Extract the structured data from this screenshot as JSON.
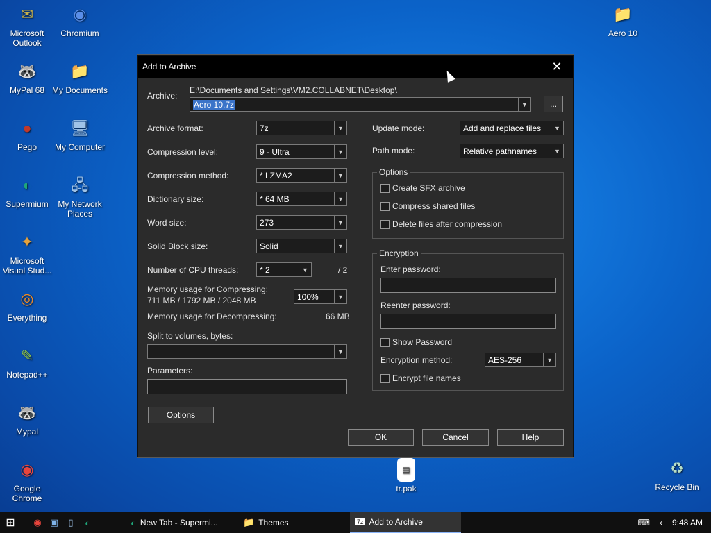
{
  "desktop": {
    "icons_left": [
      {
        "name": "microsoft-outlook",
        "label": "Microsoft Outlook",
        "glyph": "✉",
        "color": "#c8b24a"
      },
      {
        "name": "chromium",
        "label": "Chromium",
        "glyph": "◉",
        "color": "#5a8ee8"
      },
      {
        "name": "mypal-68",
        "label": "MyPal 68",
        "glyph": "🦝",
        "color": "#ffffff"
      },
      {
        "name": "my-documents",
        "label": "My Documents",
        "glyph": "📁",
        "color": "#f2d66b"
      },
      {
        "name": "pego",
        "label": "Pego",
        "glyph": "●",
        "color": "#c0392b"
      },
      {
        "name": "my-computer",
        "label": "My Computer",
        "glyph": "🖥",
        "color": "#9fc3e8"
      },
      {
        "name": "supermium",
        "label": "Supermium",
        "glyph": "◐",
        "color": "#1fa67a"
      },
      {
        "name": "my-network-places",
        "label": "My Network Places",
        "glyph": "🖧",
        "color": "#9fc3e8"
      },
      {
        "name": "microsoft-visual-studio",
        "label": "Microsoft Visual Stud...",
        "glyph": "✦",
        "color": "#e6a23c"
      },
      {
        "name": "everything",
        "label": "Everything",
        "glyph": "◎",
        "color": "#f08a24"
      },
      {
        "name": "notepad-plus-plus",
        "label": "Notepad++",
        "glyph": "✎",
        "color": "#8bc34a"
      },
      {
        "name": "mypal",
        "label": "Mypal",
        "glyph": "🦝",
        "color": "#ffffff"
      },
      {
        "name": "google-chrome",
        "label": "Google Chrome",
        "glyph": "◉",
        "color": "#e8453c"
      }
    ],
    "icon_aero10": "Aero 10",
    "icon_trpak": "tr.pak",
    "icon_recycle": "Recycle Bin"
  },
  "dialog": {
    "title": "Add to Archive",
    "archive_label": "Archive:",
    "archive_path": "E:\\Documents and Settings\\VM2.COLLABNET\\Desktop\\",
    "archive_name": "Aero 10.7z",
    "browse_label": "...",
    "archive_format_label": "Archive format:",
    "archive_format_value": "7z",
    "compression_level_label": "Compression level:",
    "compression_level_value": "9 - Ultra",
    "compression_method_label": "Compression method:",
    "compression_method_value": "* LZMA2",
    "dictionary_size_label": "Dictionary size:",
    "dictionary_size_value": "* 64 MB",
    "word_size_label": "Word size:",
    "word_size_value": "273",
    "solid_block_label": "Solid Block size:",
    "solid_block_value": "Solid",
    "cpu_threads_label": "Number of CPU threads:",
    "cpu_threads_value": "* 2",
    "cpu_threads_max": "/ 2",
    "mem_compress_label": "Memory usage for Compressing:",
    "mem_compress_value": "711 MB / 1792 MB / 2048 MB",
    "mem_percent_value": "100%",
    "mem_decompress_label": "Memory usage for Decompressing:",
    "mem_decompress_value": "66 MB",
    "split_label": "Split to volumes, bytes:",
    "parameters_label": "Parameters:",
    "options_button": "Options",
    "update_mode_label": "Update mode:",
    "update_mode_value": "Add and replace files",
    "path_mode_label": "Path mode:",
    "path_mode_value": "Relative pathnames",
    "options_group": "Options",
    "create_sfx": "Create SFX archive",
    "compress_shared": "Compress shared files",
    "delete_after": "Delete files after compression",
    "encryption_group": "Encryption",
    "enter_password_label": "Enter password:",
    "reenter_password_label": "Reenter password:",
    "show_password": "Show Password",
    "encryption_method_label": "Encryption method:",
    "encryption_method_value": "AES-256",
    "encrypt_names": "Encrypt file names",
    "ok_button": "OK",
    "cancel_button": "Cancel",
    "help_button": "Help"
  },
  "taskbar": {
    "tasks": [
      {
        "label": "New Tab - Supermi...",
        "icon": "◐"
      },
      {
        "label": "Themes",
        "icon": "📁"
      },
      {
        "label": "Add to Archive",
        "icon": "7z"
      }
    ],
    "time": "9:48 AM"
  }
}
